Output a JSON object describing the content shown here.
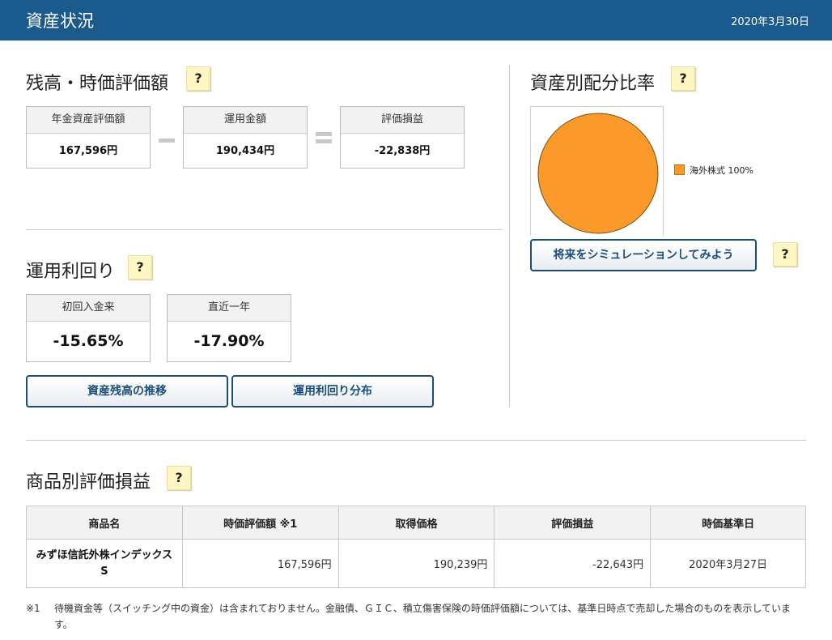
{
  "header": {
    "title": "資産状況",
    "date": "2020年3月30日"
  },
  "balance": {
    "title": "残高・時価評価額",
    "help": "?",
    "items": [
      {
        "label": "年金資産評価額",
        "value": "167,596円"
      },
      {
        "label": "運用金額",
        "value": "190,434円"
      },
      {
        "label": "評価損益",
        "value": "-22,838円"
      }
    ]
  },
  "yield": {
    "title": "運用利回り",
    "help": "?",
    "items": [
      {
        "label": "初回入金来",
        "value": "-15.65%"
      },
      {
        "label": "直近一年",
        "value": "-17.90%"
      }
    ],
    "buttons": {
      "history": "資産残高の推移",
      "distribution": "運用利回り分布"
    }
  },
  "allocation": {
    "title": "資産別配分比率",
    "help": "?",
    "simulate_button": "将来をシミュレーションしてみよう",
    "simulate_help": "?",
    "chart_data": {
      "type": "pie",
      "labels": [
        "海外株式"
      ],
      "values": [
        100
      ],
      "legend_labels": [
        "海外株式 100%"
      ],
      "colors": [
        "#f99a2a"
      ],
      "legend": "right"
    }
  },
  "products": {
    "title": "商品別評価損益",
    "help": "?",
    "columns": [
      "商品名",
      "時価評価額 ※1",
      "取得価格",
      "評価損益",
      "時価基準日"
    ],
    "rows": [
      {
        "name": "みずほ信託外株インデックスS",
        "market_value": "167,596円",
        "acquisition": "190,239円",
        "gain_loss": "-22,643円",
        "base_date": "2020年3月27日"
      }
    ]
  },
  "note": {
    "mark": "※1",
    "text": "待機資金等（スイッチング中の資金）は含まれておりません。金融債、ＧＩＣ、積立傷害保険の時価評価額については、基準日時点で売却した場合のものを表示しています。"
  }
}
